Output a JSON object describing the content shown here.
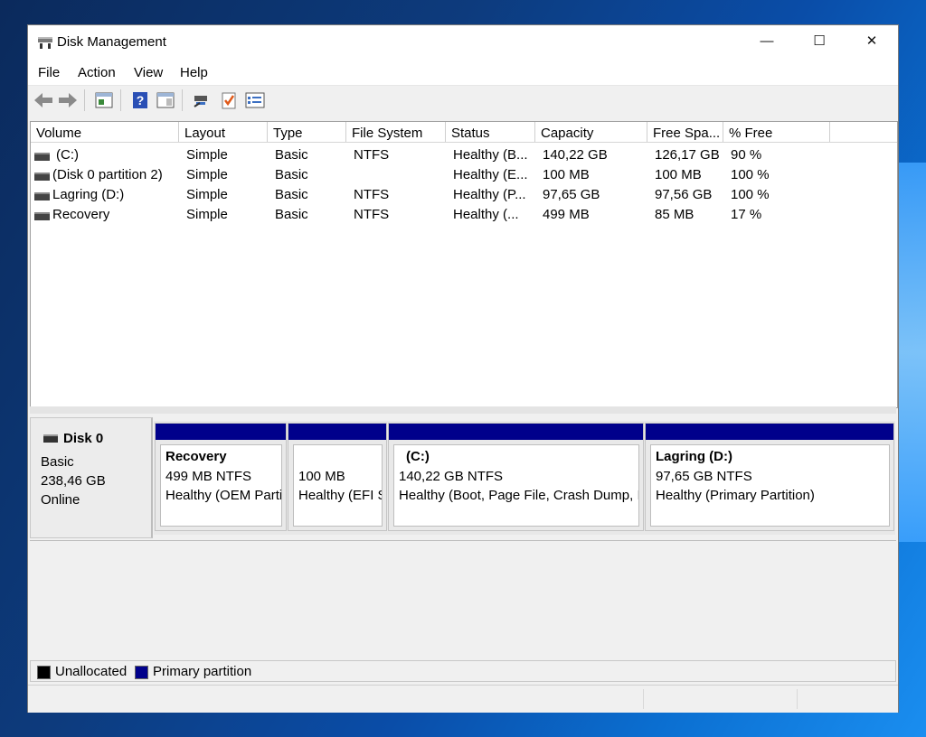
{
  "window": {
    "title": "Disk Management",
    "controls": {
      "minimize": "—",
      "maximize": "☐",
      "close": "✕"
    }
  },
  "menu": [
    "File",
    "Action",
    "View",
    "Help"
  ],
  "toolbar": [
    "back-icon",
    "forward-icon",
    "properties-icon",
    "help-icon",
    "show-hide-icon",
    "connect-icon",
    "check-icon",
    "list-icon"
  ],
  "list": {
    "columns": [
      "Volume",
      "Layout",
      "Type",
      "File System",
      "Status",
      "Capacity",
      "Free Spa...",
      "% Free"
    ],
    "rows": [
      {
        "volume": "(C:)",
        "layout": "Simple",
        "type": "Basic",
        "fs": "NTFS",
        "status": "Healthy (B...",
        "capacity": "140,22 GB",
        "free": "126,17 GB",
        "pct": "90 %"
      },
      {
        "volume": "(Disk 0 partition 2)",
        "layout": "Simple",
        "type": "Basic",
        "fs": "",
        "status": "Healthy (E...",
        "capacity": "100 MB",
        "free": "100 MB",
        "pct": "100 %"
      },
      {
        "volume": "Lagring (D:)",
        "layout": "Simple",
        "type": "Basic",
        "fs": "NTFS",
        "status": "Healthy (P...",
        "capacity": "97,65 GB",
        "free": "97,56 GB",
        "pct": "100 %"
      },
      {
        "volume": "Recovery",
        "layout": "Simple",
        "type": "Basic",
        "fs": "NTFS",
        "status": "Healthy (...",
        "capacity": "499 MB",
        "free": "85 MB",
        "pct": "17 %"
      }
    ]
  },
  "disk": {
    "name": "Disk 0",
    "type": "Basic",
    "size": "238,46 GB",
    "state": "Online",
    "partitions": [
      {
        "name": "Recovery",
        "size": "499 MB NTFS",
        "status": "Healthy (OEM Parti"
      },
      {
        "name": "",
        "size": "100 MB",
        "status": "Healthy (EFI S"
      },
      {
        "name": "(C:)",
        "size": "140,22 GB NTFS",
        "status": "Healthy (Boot, Page File, Crash Dump, I"
      },
      {
        "name": "Lagring  (D:)",
        "size": "97,65 GB NTFS",
        "status": "Healthy (Primary Partition)"
      }
    ]
  },
  "legend": [
    {
      "label": "Unallocated",
      "color": "#000000"
    },
    {
      "label": "Primary partition",
      "color": "#00008b"
    }
  ]
}
